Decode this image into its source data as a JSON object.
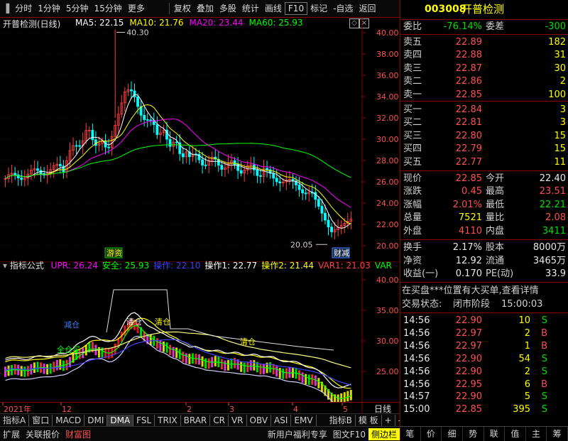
{
  "toolbar": {
    "items": [
      "分时",
      "1分钟",
      "5分钟",
      "15分钟",
      "更多",
      "复权",
      "叠加",
      "多股",
      "统计",
      "画线",
      "F10",
      "标记",
      "-自选",
      "返回"
    ]
  },
  "main_chart": {
    "title": "开普检测(日线)",
    "ma": [
      {
        "label": "MA5: 22.15",
        "color": "#ffffff"
      },
      {
        "label": "MA10: 21.76",
        "color": "#ffff00"
      },
      {
        "label": "MA20: 23.44",
        "color": "#ff00ff"
      },
      {
        "label": "MA60: 25.93",
        "color": "#00ff00"
      }
    ],
    "y_ticks": [
      "40.00",
      "38.00",
      "36.00",
      "34.00",
      "32.00",
      "30.00",
      "28.00",
      "26.00",
      "24.00",
      "22.00",
      "20.00"
    ],
    "high_label": "40.30",
    "low_label": "20.05",
    "tag1": "游资",
    "tag2": "财减"
  },
  "indicator": {
    "title": "指标公式",
    "params": [
      {
        "label": "UPR: 26.24",
        "color": "#ff00ff"
      },
      {
        "label": "安全: 25.93",
        "color": "#00ff00"
      },
      {
        "label": "操作: 22.10",
        "color": "#4040ff"
      },
      {
        "label": "操作1: 22.77",
        "color": "#ffffff"
      },
      {
        "label": "操作2: 21.44",
        "color": "#ffff00"
      },
      {
        "label": "VAR1: 21.03",
        "color": "#ff4040"
      },
      {
        "label": "VAR",
        "color": "#00ff00"
      }
    ],
    "y_ticks": [
      "40.00",
      "35.00",
      "30.00",
      "25.00"
    ],
    "annotations": [
      "减仓",
      "清仓",
      "清仓",
      "清仓",
      "全仓买"
    ]
  },
  "axis": {
    "labels": [
      "2021年",
      "12",
      "2",
      "3",
      "4",
      "5"
    ],
    "period": "日线"
  },
  "tabs": [
    "指标A",
    "窗口",
    "MACD",
    "DMI",
    "DMA",
    "FSL",
    "TRIX",
    "BRAR",
    "CR",
    "VR",
    "OBV",
    "ASI",
    "EMV",
    "指标B",
    "模 板",
    "+",
    "-"
  ],
  "bottombar": {
    "left": [
      "扩展",
      "关联报价",
      "财富图"
    ],
    "right": [
      "新用户福利专享",
      "图文F10",
      "侧边栏"
    ]
  },
  "quote": {
    "code": "003008",
    "name": "开普检测",
    "webi_label": "委比",
    "webi_value": "-76.14%",
    "weicha_label": "委差",
    "weicha_value": "-300",
    "sell": [
      {
        "label": "卖五",
        "price": "22.89",
        "vol": "182"
      },
      {
        "label": "卖四",
        "price": "22.88",
        "vol": "31"
      },
      {
        "label": "卖三",
        "price": "22.87",
        "vol": "30"
      },
      {
        "label": "卖二",
        "price": "22.86",
        "vol": "2"
      },
      {
        "label": "卖一",
        "price": "22.85",
        "vol": "100"
      }
    ],
    "buy": [
      {
        "label": "买一",
        "price": "22.84",
        "vol": "3"
      },
      {
        "label": "买二",
        "price": "22.81",
        "vol": "3"
      },
      {
        "label": "买三",
        "price": "22.80",
        "vol": "15"
      },
      {
        "label": "买四",
        "price": "22.79",
        "vol": "15"
      },
      {
        "label": "买五",
        "price": "22.77",
        "vol": "11"
      }
    ],
    "stats": [
      {
        "l1": "现价",
        "v1": "22.85",
        "c1": "red",
        "l2": "今开",
        "v2": "22.40",
        "c2": "wht"
      },
      {
        "l1": "涨跌",
        "v1": "0.45",
        "c1": "red",
        "l2": "最高",
        "v2": "23.51",
        "c2": "red"
      },
      {
        "l1": "涨幅",
        "v1": "2.01%",
        "c1": "red",
        "l2": "最低",
        "v2": "22.21",
        "c2": "grn"
      },
      {
        "l1": "总量",
        "v1": "7521",
        "c1": "yel",
        "l2": "量比",
        "v2": "2.08",
        "c2": "red"
      },
      {
        "l1": "外盘",
        "v1": "4110",
        "c1": "red",
        "l2": "内盘",
        "v2": "3411",
        "c2": "grn"
      }
    ],
    "stats2": [
      {
        "l1": "换手",
        "v1": "2.17%",
        "l2": "股本",
        "v2": "8000万"
      },
      {
        "l1": "净资",
        "v1": "12.92",
        "l2": "流通",
        "v2": "3465万"
      },
      {
        "l1": "收益(一)",
        "v1": "0.170",
        "l2": "PE(动)",
        "v2": "33.9"
      }
    ],
    "notice": "在买盘***位置有大买单,查看详情",
    "status_label": "交易状态:",
    "status_value": "闭市阶段",
    "status_time": "15:00:03",
    "ticks": [
      {
        "t": "14:56",
        "p": "22.90",
        "v": "10",
        "d": "S"
      },
      {
        "t": "14:56",
        "p": "22.97",
        "v": "2",
        "d": "B"
      },
      {
        "t": "14:56",
        "p": "22.97",
        "v": "1",
        "d": "B"
      },
      {
        "t": "14:56",
        "p": "22.90",
        "v": "54",
        "d": "S"
      },
      {
        "t": "14:56",
        "p": "22.90",
        "v": "2",
        "d": "S"
      },
      {
        "t": "14:56",
        "p": "22.95",
        "v": "6",
        "d": "B"
      },
      {
        "t": "14:57",
        "p": "22.90",
        "v": "5",
        "d": "S"
      },
      {
        "t": "15:00",
        "p": "22.85",
        "v": "395",
        "d": "S"
      }
    ],
    "buttons": [
      "笔",
      "价",
      "细",
      "势",
      "联",
      "值",
      "主",
      "筹"
    ]
  }
}
